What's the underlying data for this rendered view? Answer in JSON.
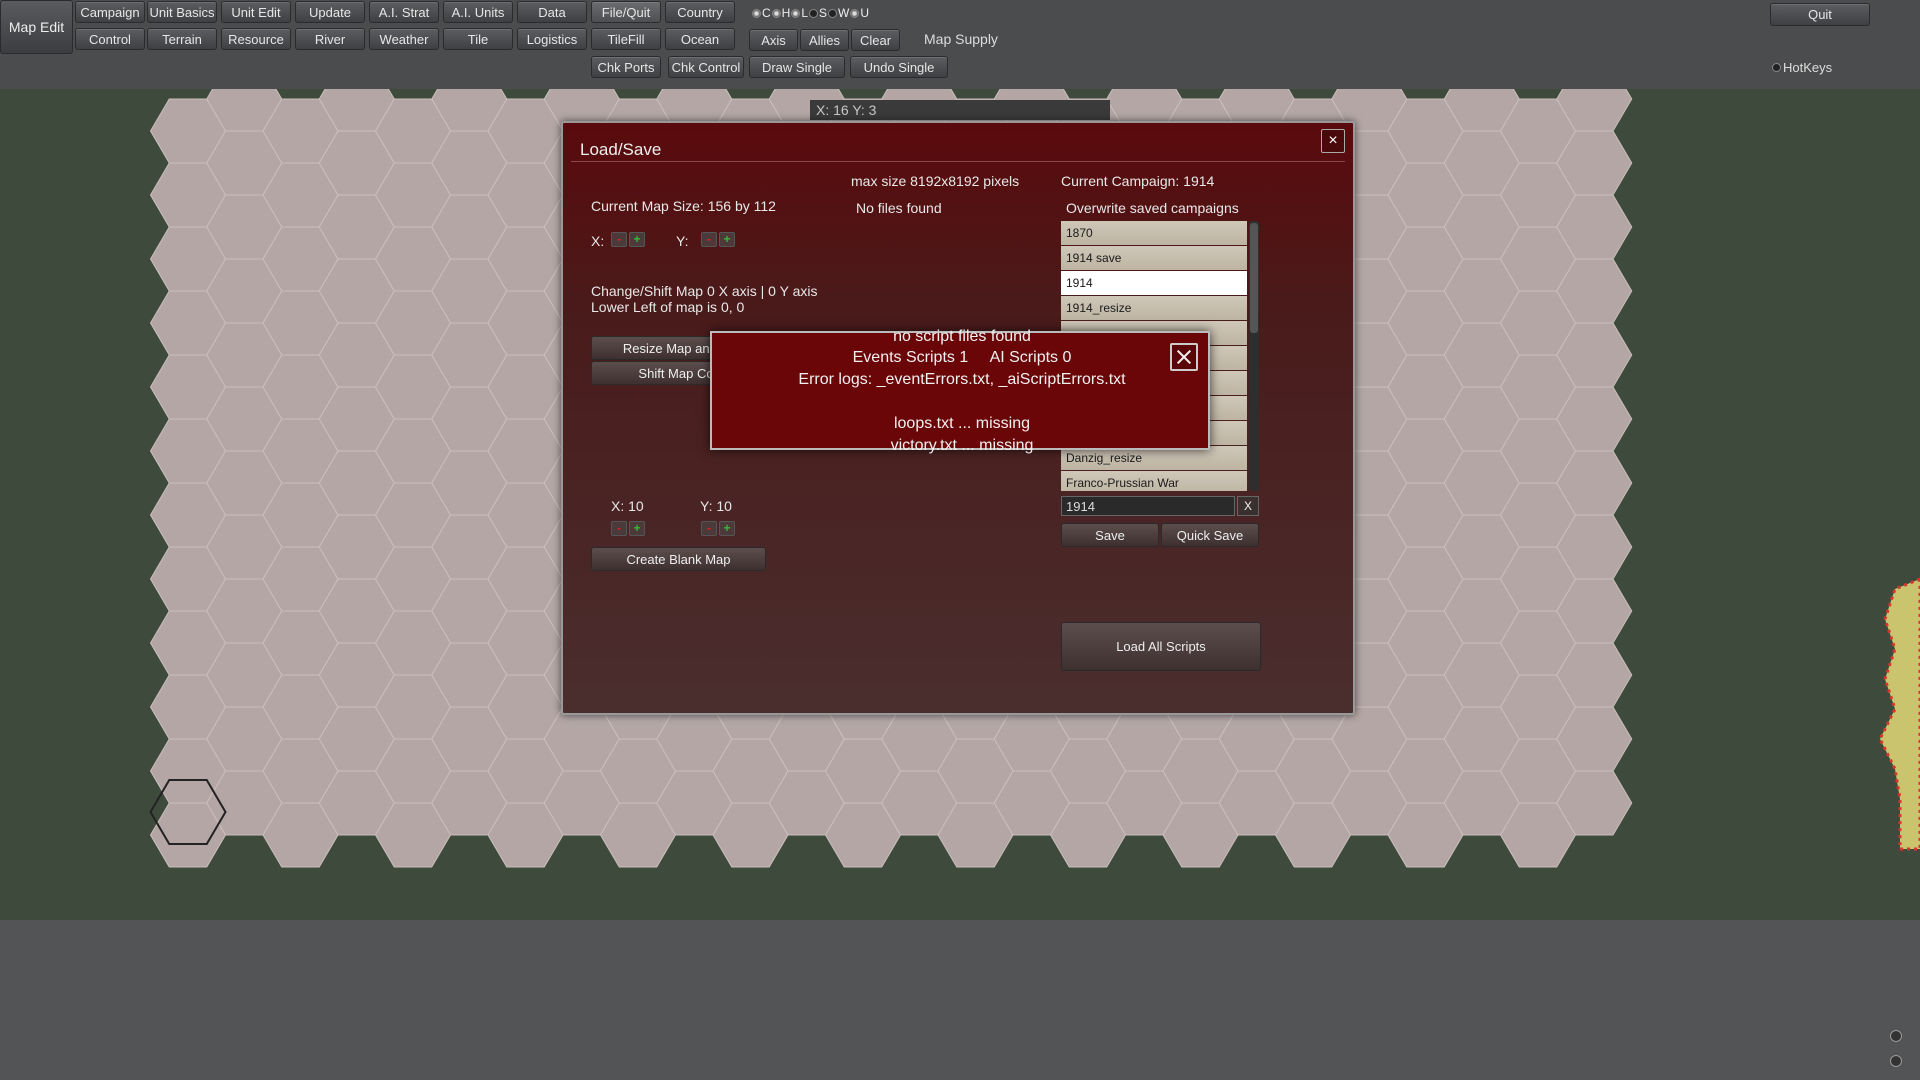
{
  "toolbar": {
    "map_edit": "Map Edit",
    "row1": [
      "Campaign",
      "Unit Basics",
      "Unit Edit",
      "Update",
      "A.I. Strat",
      "A.I. Units",
      "Data",
      "File/Quit",
      "Country"
    ],
    "row2": [
      "Control",
      "Terrain",
      "Resource",
      "River",
      "Weather",
      "Tile",
      "Logistics",
      "TileFill",
      "Ocean"
    ],
    "row3": [
      "Chk Ports",
      "Chk Control",
      "Draw Single",
      "Undo Single"
    ],
    "side": [
      "Axis",
      "Allies",
      "Clear"
    ],
    "map_supply": "Map Supply",
    "toggles": [
      "C",
      "H",
      "L",
      "S",
      "W",
      "U"
    ],
    "quit": "Quit",
    "hotkeys": "HotKeys"
  },
  "coords": "X: 16 Y: 3",
  "dialog": {
    "title": "Load/Save",
    "close": "×",
    "max_size": "max size 8192x8192 pixels",
    "no_files": "No files found",
    "current_campaign": "Current Campaign: 1914",
    "overwrite": "Overwrite saved campaigns",
    "map_size": "Current Map Size: 156 by 112",
    "x_label": "X:",
    "y_label": "Y:",
    "shift_info": "Change/Shift Map 0 X axis | 0 Y axis",
    "lower_left": "Lower Left of map is 0, 0",
    "resize_btn": "Resize Map and S",
    "shift_btn": "Shift Map Co",
    "x10": "X: 10",
    "y10": "Y: 10",
    "create_blank": "Create Blank Map",
    "campaigns": [
      "1870",
      "1914 save",
      "1914",
      "1914_resize",
      "",
      "",
      "",
      "",
      "",
      "Danzig_resize",
      "Franco-Prussian War"
    ],
    "selected_campaign": "1914",
    "name_value": "1914",
    "name_clear": "X",
    "save": "Save",
    "quick_save": "Quick Save",
    "load_all": "Load All Scripts",
    "minus": "-",
    "plus": "+"
  },
  "popup": {
    "line1": "no script files found",
    "line2": "Events Scripts 1     AI Scripts 0",
    "line3": "Error logs: _eventErrors.txt, _aiScriptErrors.txt",
    "line4": "loops.txt ... missing",
    "line5": "victory.txt ... missing"
  },
  "colors": {
    "hex_fill": "#b3a6a5",
    "hex_edge": "#cbbfbc",
    "background": "#3e4a3c",
    "dialog": "#5a0a0c",
    "popup": "#6a0508",
    "border_dots": "#d6352b",
    "border_fill": "#c9c46d"
  }
}
